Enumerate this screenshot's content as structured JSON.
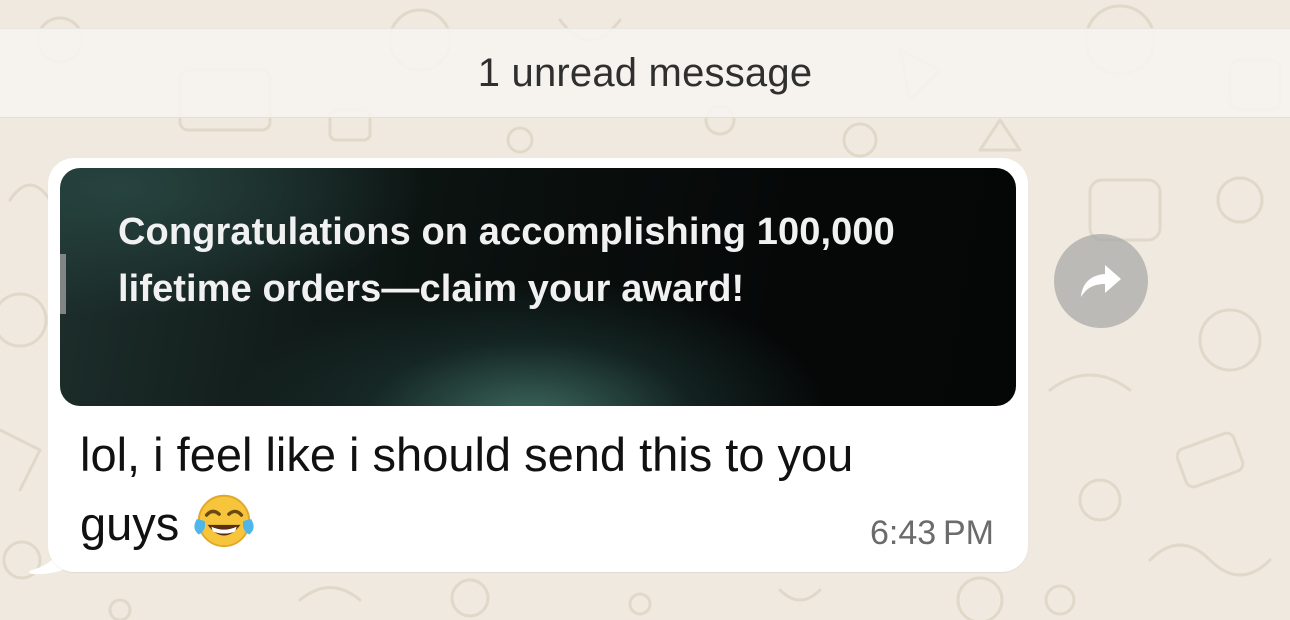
{
  "banner": {
    "unread_label": "1 unread message"
  },
  "message": {
    "image_caption": "Congratulations on accomplishing 100,000 lifetime orders—claim your award!",
    "text": "lol, i feel like i should send this to you guys",
    "emoji": "😂",
    "time": "6:43 PM"
  },
  "actions": {
    "forward_icon": "forward-arrow-icon"
  },
  "colors": {
    "wallpaper": "#efe9df",
    "bubble": "#ffffff",
    "timestamp": "#6b6b6b",
    "forward_button": "#aaaaa8"
  }
}
